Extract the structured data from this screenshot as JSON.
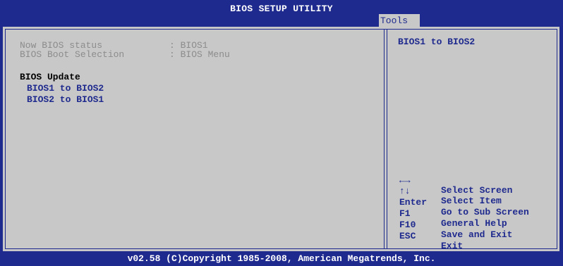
{
  "header": {
    "title": "BIOS SETUP UTILITY",
    "active_tab": "Tools"
  },
  "status": {
    "bios_status_label": "Now BIOS status",
    "bios_status_value": ": BIOS1",
    "boot_selection_label": "BIOS Boot Selection",
    "boot_selection_value": ": BIOS Menu"
  },
  "update": {
    "heading": "BIOS Update",
    "items": [
      "BIOS1 to BIOS2",
      "BIOS2 to BIOS1"
    ]
  },
  "help": {
    "description": "BIOS1 to BIOS2",
    "keys": [
      {
        "key": "←→",
        "icon": "left-right-arrows-icon",
        "action": "Select Screen"
      },
      {
        "key": "↑↓",
        "icon": "up-down-arrows-icon",
        "action": "Select Item"
      },
      {
        "key": "Enter",
        "action": "Go to Sub Screen"
      },
      {
        "key": "F1",
        "action": "General Help"
      },
      {
        "key": "F10",
        "action": "Save and Exit"
      },
      {
        "key": "ESC",
        "action": "Exit"
      }
    ]
  },
  "footer": {
    "copyright": "v02.58 (C)Copyright 1985-2008, American Megatrends, Inc."
  },
  "colors": {
    "background": "#1f2a8e",
    "panel": "#c8c8c8",
    "highlight_text": "#1f2a8e",
    "disabled_text": "#8c8c8c"
  }
}
